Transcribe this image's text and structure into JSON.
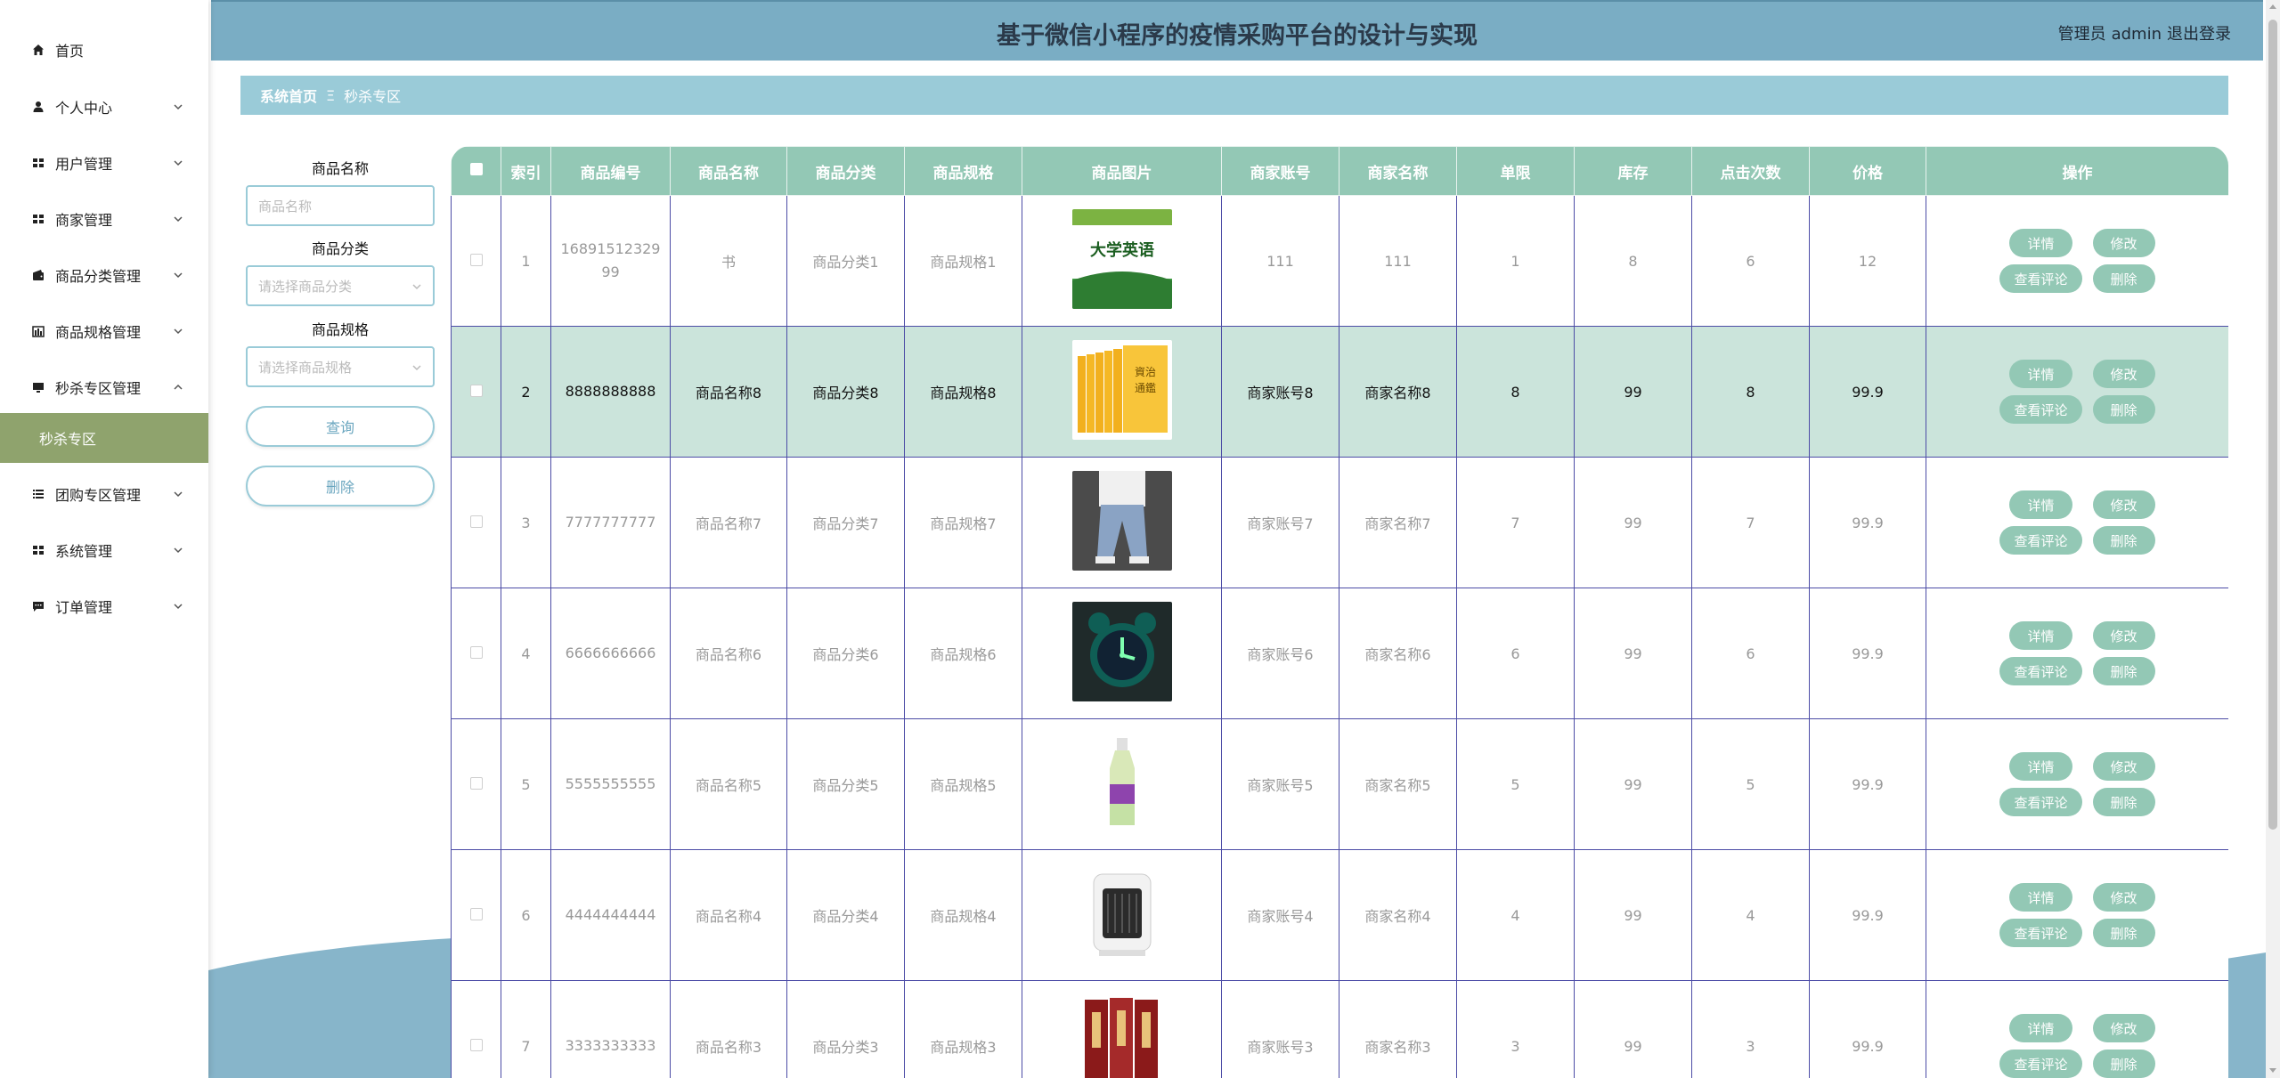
{
  "app": {
    "title": "基于微信小程序的疫情采购平台的设计与实现",
    "role": "管理员",
    "username": "admin",
    "logout": "退出登录"
  },
  "sidebar": {
    "items": [
      {
        "label": "首页",
        "icon": "home-icon"
      },
      {
        "label": "个人中心",
        "icon": "user-icon"
      },
      {
        "label": "用户管理",
        "icon": "grid-icon"
      },
      {
        "label": "商家管理",
        "icon": "grid-icon"
      },
      {
        "label": "商品分类管理",
        "icon": "wallet-icon"
      },
      {
        "label": "商品规格管理",
        "icon": "bar-chart-icon"
      },
      {
        "label": "秒杀专区管理",
        "icon": "monitor-icon"
      },
      {
        "label": "团购专区管理",
        "icon": "list-icon"
      },
      {
        "label": "系统管理",
        "icon": "grid-icon"
      },
      {
        "label": "订单管理",
        "icon": "message-icon"
      }
    ],
    "active_sub": "秒杀专区"
  },
  "breadcrumb": {
    "home": "系统首页",
    "separator": "Ξ",
    "current": "秒杀专区"
  },
  "search": {
    "name_label": "商品名称",
    "name_placeholder": "商品名称",
    "category_label": "商品分类",
    "category_placeholder": "请选择商品分类",
    "spec_label": "商品规格",
    "spec_placeholder": "请选择商品规格",
    "query_button": "查询",
    "delete_button": "删除"
  },
  "table": {
    "headers": [
      "索引",
      "商品编号",
      "商品名称",
      "商品分类",
      "商品规格",
      "商品图片",
      "商家账号",
      "商家名称",
      "单限",
      "库存",
      "点击次数",
      "价格",
      "操作"
    ],
    "rows": [
      {
        "index": "1",
        "code": "1689151232999",
        "name": "书",
        "category": "商品分类1",
        "spec": "商品规格1",
        "image": "english-textbook",
        "account": "111",
        "merchant": "111",
        "limit": "1",
        "stock": "8",
        "clicks": "6",
        "price": "12"
      },
      {
        "index": "2",
        "code": "8888888888",
        "name": "商品名称8",
        "category": "商品分类8",
        "spec": "商品规格8",
        "image": "yellow-books",
        "account": "商家账号8",
        "merchant": "商家名称8",
        "limit": "8",
        "stock": "99",
        "clicks": "8",
        "price": "99.9"
      },
      {
        "index": "3",
        "code": "7777777777",
        "name": "商品名称7",
        "category": "商品分类7",
        "spec": "商品规格7",
        "image": "jeans",
        "account": "商家账号7",
        "merchant": "商家名称7",
        "limit": "7",
        "stock": "99",
        "clicks": "7",
        "price": "99.9"
      },
      {
        "index": "4",
        "code": "6666666666",
        "name": "商品名称6",
        "category": "商品分类6",
        "spec": "商品规格6",
        "image": "alarm-clock",
        "account": "商家账号6",
        "merchant": "商家名称6",
        "limit": "6",
        "stock": "99",
        "clicks": "6",
        "price": "99.9"
      },
      {
        "index": "5",
        "code": "5555555555",
        "name": "商品名称5",
        "category": "商品分类5",
        "spec": "商品规格5",
        "image": "drink-bottle",
        "account": "商家账号5",
        "merchant": "商家名称5",
        "limit": "5",
        "stock": "99",
        "clicks": "5",
        "price": "99.9"
      },
      {
        "index": "6",
        "code": "4444444444",
        "name": "商品名称4",
        "category": "商品分类4",
        "spec": "商品规格4",
        "image": "heater",
        "account": "商家账号4",
        "merchant": "商家名称4",
        "limit": "4",
        "stock": "99",
        "clicks": "4",
        "price": "99.9"
      },
      {
        "index": "7",
        "code": "3333333333",
        "name": "商品名称3",
        "category": "商品分类3",
        "spec": "商品规格3",
        "image": "red-books",
        "account": "商家账号3",
        "merchant": "商家名称3",
        "limit": "3",
        "stock": "99",
        "clicks": "3",
        "price": "99.9"
      }
    ],
    "highlighted_row": 2,
    "actions": {
      "detail": "详情",
      "edit": "修改",
      "reviews": "查看评论",
      "delete": "删除"
    }
  },
  "colors": {
    "topbar": "#7aadc4",
    "breadcrumb": "#9acbd8",
    "table_header": "#93c8b5",
    "highlight_row": "#cbe4db",
    "active_submenu": "#8fa36d"
  }
}
